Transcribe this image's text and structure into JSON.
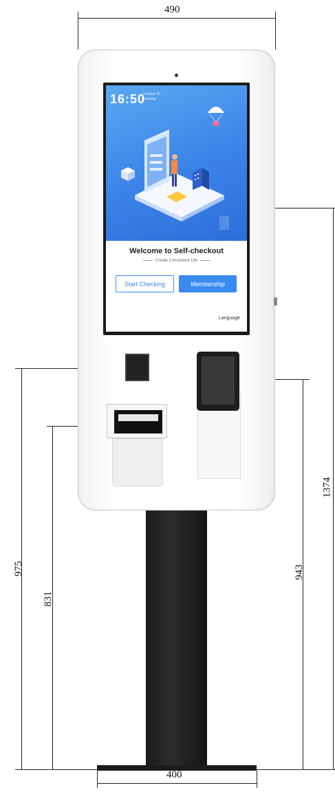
{
  "dimensions": {
    "width_top": "490",
    "base_width": "400",
    "height_total": "1374",
    "height_screen_bottom": "975",
    "height_printer": "831",
    "height_terminal": "943"
  },
  "screen": {
    "time": "16:50",
    "date_line1": "October 25",
    "date_line2": "Tuesday",
    "welcome": "Welcome to Self-checkout",
    "slogan": "Create Convenient Life",
    "start_button": "Start Checking",
    "membership_button": "Membership",
    "language_link": "Language",
    "accent_color": "#3b8af0"
  },
  "icons": {
    "hero": "isometric-shopping-illustration-icon",
    "parachute": "parachute-icon",
    "camera": "camera-icon"
  }
}
